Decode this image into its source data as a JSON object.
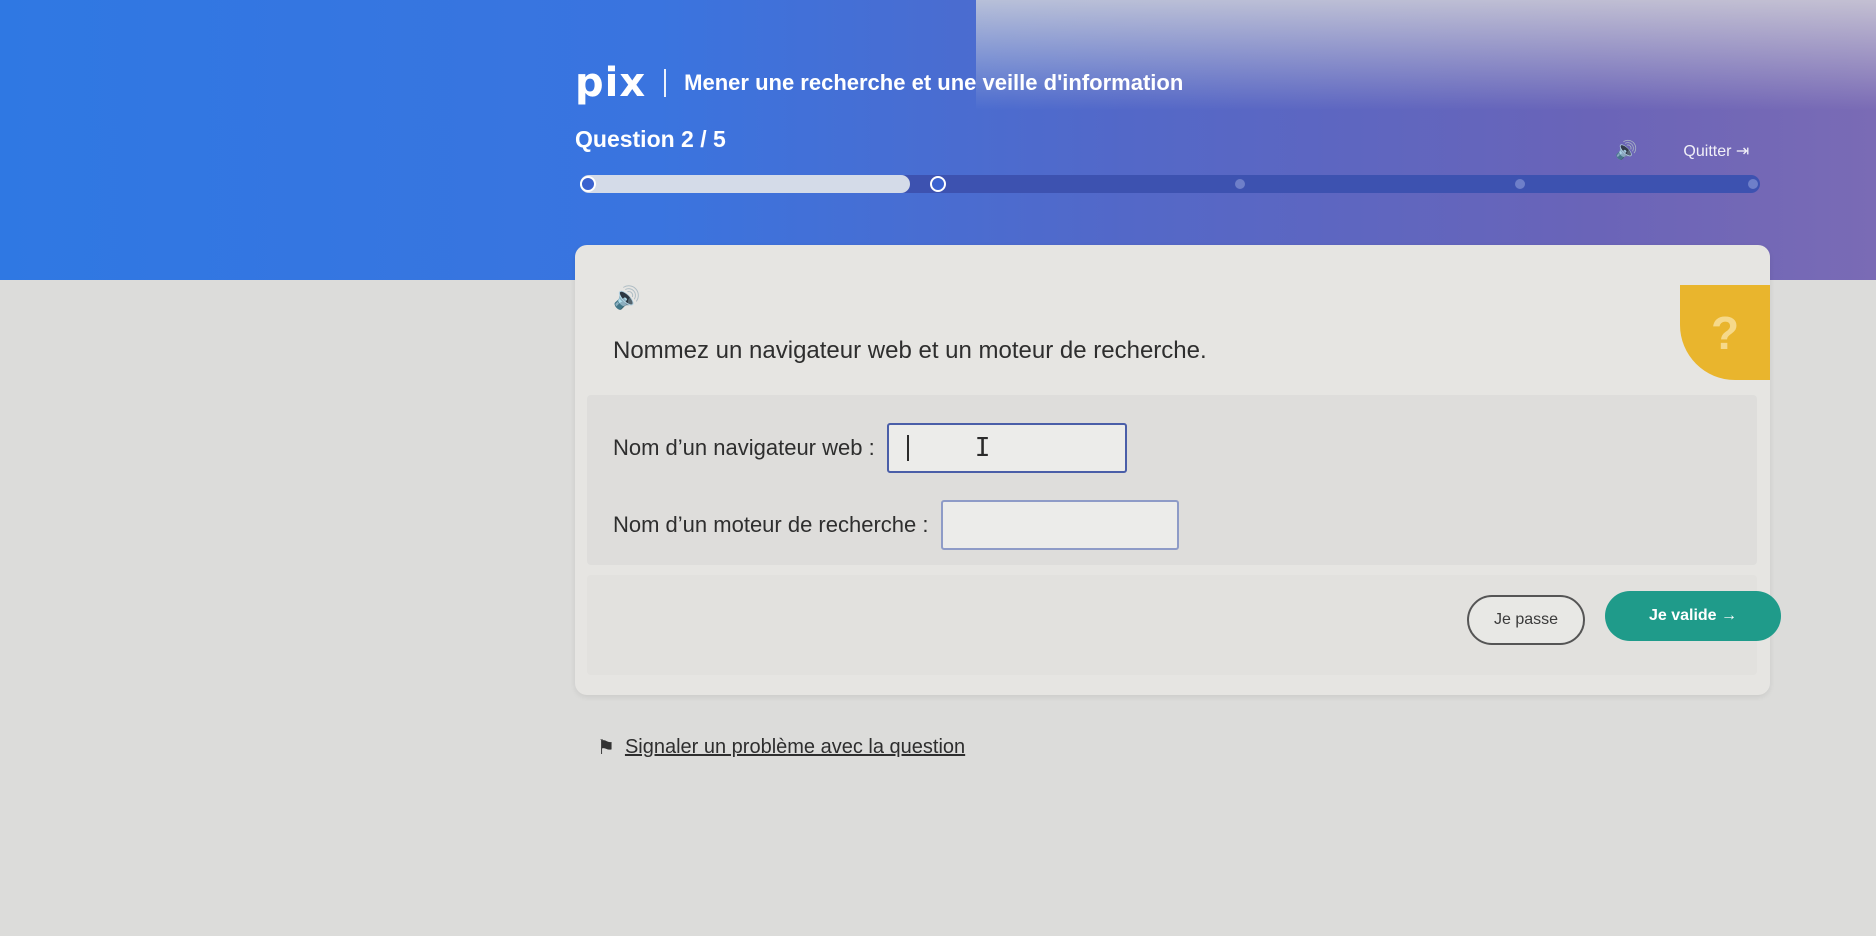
{
  "header": {
    "logo": "pix",
    "module_title": "Mener une recherche et une veille d'information",
    "question_counter": "Question 2 / 5",
    "quit_label": "Quitter ⇥",
    "sound_icon": "🔊"
  },
  "progress": {
    "current": 2,
    "total": 5,
    "fraction": 0.28
  },
  "question": {
    "sound_icon": "🔊",
    "tutor_icon": "?",
    "instruction": "Nommez un navigateur web et un moteur de recherche.",
    "fields": [
      {
        "label": "Nom d’un navigateur web :",
        "value": ""
      },
      {
        "label": "Nom d’un moteur de recherche :",
        "value": ""
      }
    ]
  },
  "actions": {
    "skip_label": "Je passe",
    "validate_label": "Je valide →"
  },
  "footer": {
    "flag_icon": "⚑",
    "report_label": "Signaler un problème avec la question"
  },
  "colors": {
    "header_blue": "#2f78e3",
    "header_purple": "#6a64b8",
    "validate_teal": "#1f9b8a",
    "tutor_yellow": "#e9b52d"
  }
}
